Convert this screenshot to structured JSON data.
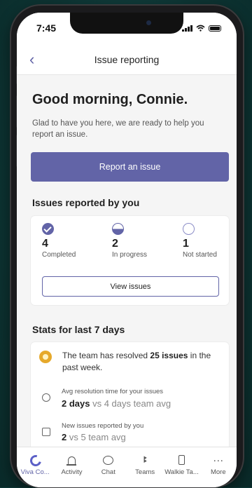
{
  "status_bar": {
    "time": "7:45"
  },
  "nav": {
    "back_icon": "chevron-left-icon",
    "title": "Issue reporting"
  },
  "greeting": "Good morning, Connie.",
  "subtext": "Glad to have you here, we are ready to help you report an issue.",
  "report_button": "Report an issue",
  "issues_section": {
    "title": "Issues reported by you",
    "stats": [
      {
        "icon": "check-circle-icon",
        "count": "4",
        "label": "Completed"
      },
      {
        "icon": "half-circle-icon",
        "count": "2",
        "label": "In progress"
      },
      {
        "icon": "empty-circle-icon",
        "count": "1",
        "label": "Not started"
      }
    ],
    "view_button": "View issues"
  },
  "stats_section": {
    "title": "Stats for last 7 days",
    "resolved": {
      "prefix": "The team has resolved ",
      "count": "25 issues",
      "suffix": " in the past week."
    },
    "avg_resolution": {
      "label": "Avg resolution time for your issues",
      "value": "2 days",
      "comparison": " vs 4 days team avg"
    },
    "new_issues": {
      "label": "New issues reported by you",
      "value": "2",
      "comparison": " vs 5 team avg"
    }
  },
  "tabbar": [
    {
      "label": "Viva Co...",
      "icon": "viva-connections-icon",
      "active": true
    },
    {
      "label": "Activity",
      "icon": "bell-icon",
      "active": false
    },
    {
      "label": "Chat",
      "icon": "chat-icon",
      "active": false
    },
    {
      "label": "Teams",
      "icon": "teams-icon",
      "active": false
    },
    {
      "label": "Walkie Ta...",
      "icon": "walkie-talkie-icon",
      "active": false
    },
    {
      "label": "More",
      "icon": "more-icon",
      "active": false
    }
  ],
  "colors": {
    "accent": "#6264a7",
    "background": "#0f3b3a",
    "medal": "#e6a92b"
  }
}
